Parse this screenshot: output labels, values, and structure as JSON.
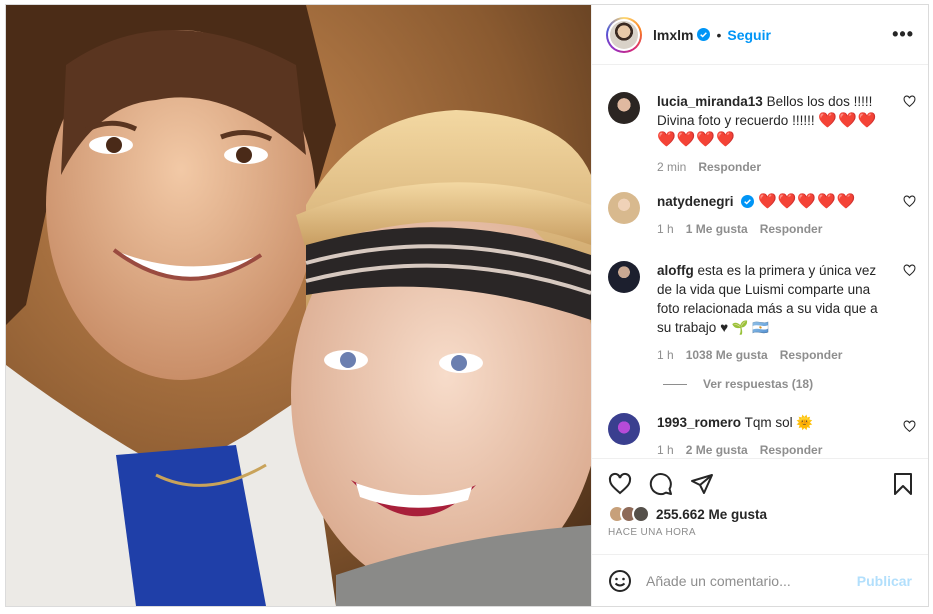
{
  "header": {
    "username": "lmxlm",
    "separator": "•",
    "follow_label": "Seguir",
    "more_label": "•••"
  },
  "comments": [
    {
      "username": "lucia_miranda13",
      "text": "Bellos los dos !!!!! Divina foto y recuerdo !!!!!!",
      "emoji": "❤️❤️❤️❤️❤️❤️❤️",
      "time": "2 min",
      "likes": "",
      "reply_label": "Responder",
      "avatar_color": "#2b2522"
    },
    {
      "username": "natydenegri",
      "text": "",
      "emoji": "❤️❤️❤️❤️❤️",
      "verified": true,
      "time": "1 h",
      "likes": "1 Me gusta",
      "reply_label": "Responder",
      "avatar_color": "#d8b98e"
    },
    {
      "username": "aloffg",
      "text": "esta es la primera y única vez de la vida que Luismi comparte una foto relacionada más a su vida que a su trabajo",
      "emoji": "♥ 🌱 🇦🇷",
      "time": "1 h",
      "likes": "1038 Me gusta",
      "reply_label": "Responder",
      "avatar_color": "#1c1f2e",
      "view_replies": "Ver respuestas (18)"
    },
    {
      "username": "1993_romero",
      "text": "Tqm sol",
      "emoji": "🌞",
      "time": "1 h",
      "likes": "2 Me gusta",
      "reply_label": "Responder",
      "avatar_color": "#3a3f8f"
    }
  ],
  "post": {
    "likes_text": "255.662 Me gusta",
    "time_ago": "HACE UNA HORA"
  },
  "add_comment": {
    "placeholder": "Añade un comentario...",
    "post_label": "Publicar"
  },
  "colors": {
    "accent": "#0095f6",
    "muted": "#8e8e8e",
    "heart_emoji": "#ed1c24",
    "post_disabled": "#b2dffc"
  },
  "icons": {
    "like": "heart-outline-icon",
    "comment": "speech-bubble-icon",
    "share": "paper-plane-icon",
    "save": "bookmark-icon",
    "emoji": "smiley-icon",
    "verified": "verified-badge-icon",
    "more": "ellipsis-icon"
  }
}
